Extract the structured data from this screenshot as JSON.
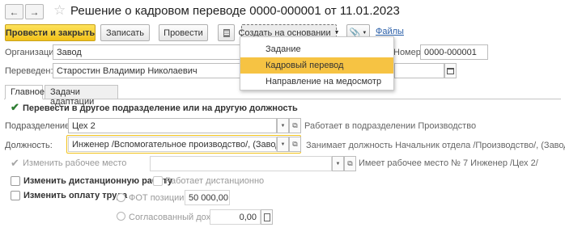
{
  "header": {
    "title": "Решение о кадровом переводе 0000-000001 от 11.01.2023"
  },
  "toolbar": {
    "post_close_label": "Провести и закрыть",
    "save_label": "Записать",
    "post_label": "Провести",
    "create_based_label": "Создать на основании",
    "files_label": "Файлы"
  },
  "create_based_menu": {
    "items": [
      {
        "label": "Задание"
      },
      {
        "label": "Кадровый перевод"
      },
      {
        "label": "Направление на медосмотр"
      }
    ]
  },
  "form": {
    "organization_label": "Организация:",
    "organization_value": "Завод",
    "number_label": "Номер:",
    "number_value": "0000-000001",
    "transferred_label": "Переведен:",
    "transferred_value": "Старостин Владимир Николаевич"
  },
  "tabs": [
    {
      "label": "Главное"
    },
    {
      "label": "Задачи адаптации"
    }
  ],
  "main": {
    "transfer_checkbox_label": "Перевести в другое подразделение или на другую должность",
    "department_label": "Подразделение:",
    "department_value": "Цех 2",
    "department_note": "Работает в подразделении Производство",
    "position_label": "Должность:",
    "position_value": "Инженер /Вспомогательное производство/, (Завод)",
    "position_note": "Занимает должность Начальник отдела /Производство/, (Завод)",
    "workplace_checkbox_label": "Изменить рабочее место",
    "workplace_note": "Имеет рабочее место № 7 Инженер /Цех 2/",
    "remote_checkbox_label": "Изменить дистанционную работу",
    "remote_works_label": "Работает дистанционно",
    "pay_checkbox_label": "Изменить оплату труда",
    "fot_label": "ФОТ позиции",
    "fot_value": "50 000,00",
    "agreed_income_label": "Согласованный доход",
    "agreed_income_value": "0,00"
  }
}
